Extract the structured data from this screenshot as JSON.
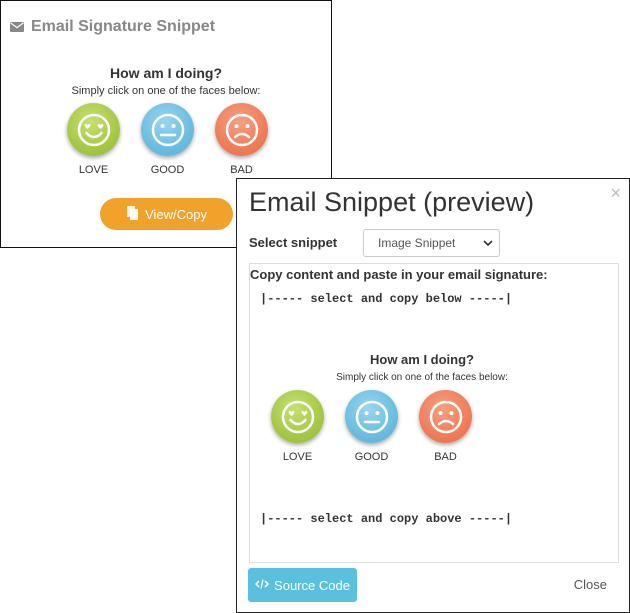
{
  "card": {
    "title": "Email Signature Snippet",
    "question": "How am I doing?",
    "subtitle": "Simply click on one of the faces below:",
    "faces": [
      {
        "label": "LOVE",
        "color": "#a6c846"
      },
      {
        "label": "GOOD",
        "color": "#6bbde0"
      },
      {
        "label": "BAD",
        "color": "#ef7d59"
      }
    ],
    "view_copy_label": "View/Copy",
    "accent": "#f0a22b"
  },
  "modal": {
    "title": "Email Snippet (preview)",
    "close_icon": "×",
    "select_label": "Select snippet",
    "select_value": "Image Snippet",
    "instructions": "Copy content and paste in your email signature:",
    "copy_below": "|----- select and copy below -----|",
    "copy_above": "|----- select and copy above -----|",
    "preview": {
      "question": "How am I doing?",
      "subtitle": "Simply click on one of the faces below:",
      "faces": [
        {
          "label": "LOVE"
        },
        {
          "label": "GOOD"
        },
        {
          "label": "BAD"
        }
      ]
    },
    "source_code_label": "Source Code",
    "close_label": "Close",
    "source_btn_color": "#5bc0de"
  }
}
